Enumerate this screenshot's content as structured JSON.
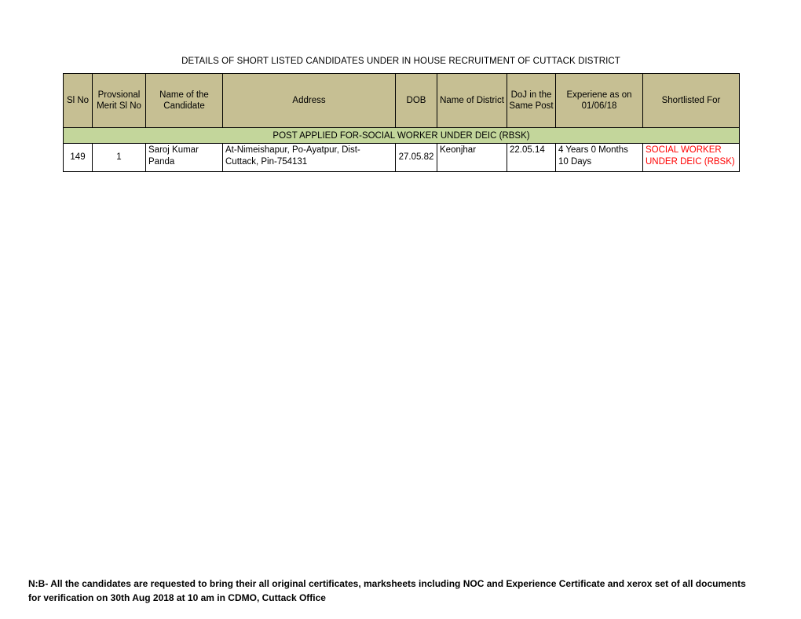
{
  "document": {
    "title": "DETAILS OF SHORT LISTED CANDIDATES UNDER IN HOUSE RECRUITMENT OF CUTTACK DISTRICT"
  },
  "table": {
    "headers": [
      "Sl No",
      "Provsional Merit Sl No",
      "Name of the Candidate",
      "Address",
      "DOB",
      "Name of District",
      "DoJ in the Same Post",
      "Experiene as on 01/06/18",
      "Shortlisted For"
    ],
    "post_band": "POST APPLIED FOR-SOCIAL WORKER UNDER DEIC (RBSK)",
    "rows": [
      {
        "sl_no": "149",
        "merit_sl_no": "1",
        "name": "Saroj Kumar Panda",
        "address": "At-Nimeishapur, Po-Ayatpur, Dist-Cuttack, Pin-754131",
        "dob": "27.05.82",
        "district": "Keonjhar",
        "doj": "22.05.14",
        "experience": "4 Years 0 Months 10 Days",
        "shortlisted_for": "SOCIAL WORKER UNDER DEIC (RBSK)"
      }
    ]
  },
  "note": {
    "line1": "N:B- All the candidates are requested to bring their all original certificates, marksheets including NOC and Experience Certificate and xerox set of all documents",
    "line2": "for verification on 30th Aug 2018 at 10 am in CDMO, Cuttack Office"
  },
  "colors": {
    "header_background": "#c6bf93",
    "post_band_background": "#c3d69b",
    "shortlisted_text": "#ff0000",
    "grid_line": "#000000",
    "page_background": "#ffffff"
  }
}
